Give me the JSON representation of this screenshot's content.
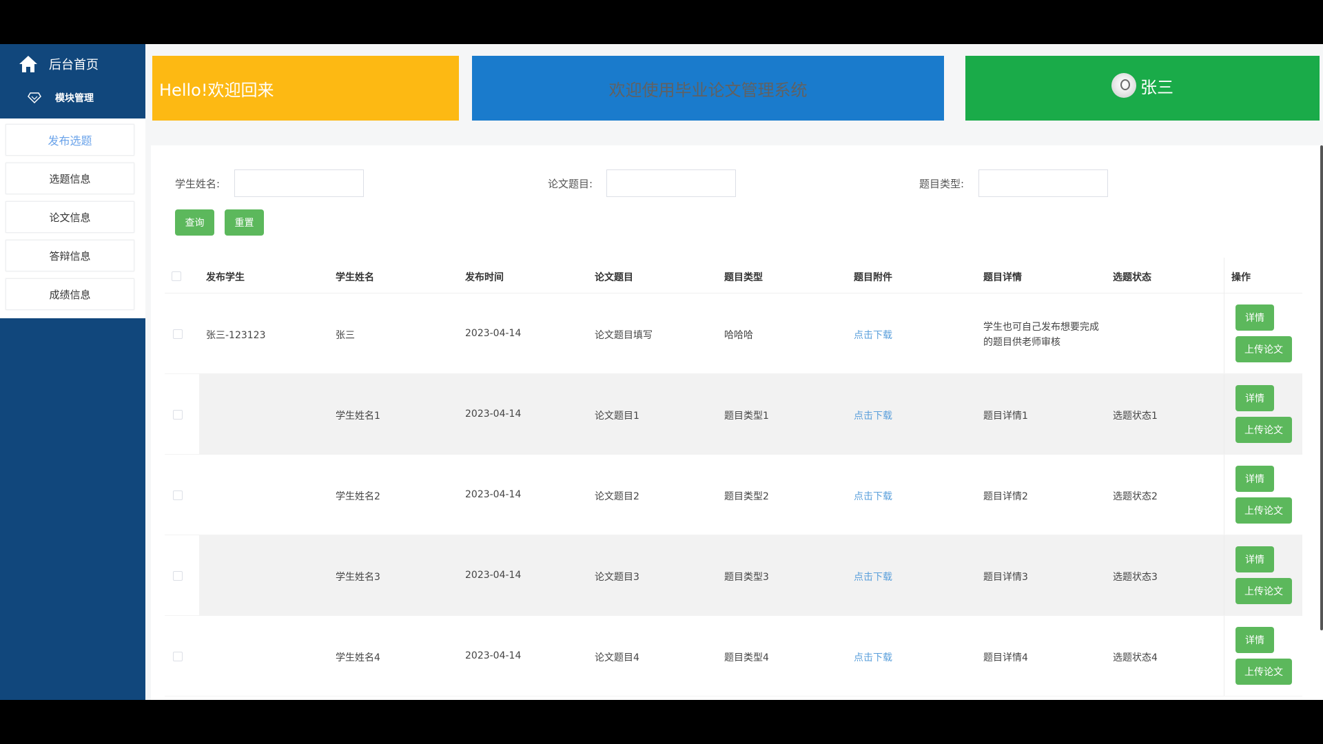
{
  "sidebar": {
    "home_label": "后台首页",
    "module_label": "模块管理",
    "items": [
      {
        "label": "发布选题",
        "active": true
      },
      {
        "label": "选题信息",
        "active": false
      },
      {
        "label": "论文信息",
        "active": false
      },
      {
        "label": "答辩信息",
        "active": false
      },
      {
        "label": "成绩信息",
        "active": false
      }
    ]
  },
  "banners": {
    "hello": "Hello!欢迎回来",
    "system": "欢迎使用毕业论文管理系统",
    "user": "张三"
  },
  "search": {
    "student_name_label": "学生姓名:",
    "thesis_title_label": "论文题目:",
    "topic_type_label": "题目类型:",
    "query_button": "查询",
    "reset_button": "重置"
  },
  "table": {
    "headers": [
      "发布学生",
      "学生姓名",
      "发布时间",
      "论文题目",
      "题目类型",
      "题目附件",
      "题目详情",
      "选题状态",
      "操作"
    ],
    "rows": [
      {
        "publisher": "张三-123123",
        "name": "张三",
        "time": "2023-04-14",
        "title": "论文题目填写",
        "type": "哈哈哈",
        "attachment": "点击下载",
        "detail": "学生也可自己发布想要完成的题目供老师审核",
        "status": ""
      },
      {
        "publisher": "",
        "name": "学生姓名1",
        "time": "2023-04-14",
        "title": "论文题目1",
        "type": "题目类型1",
        "attachment": "点击下载",
        "detail": "题目详情1",
        "status": "选题状态1"
      },
      {
        "publisher": "",
        "name": "学生姓名2",
        "time": "2023-04-14",
        "title": "论文题目2",
        "type": "题目类型2",
        "attachment": "点击下载",
        "detail": "题目详情2",
        "status": "选题状态2"
      },
      {
        "publisher": "",
        "name": "学生姓名3",
        "time": "2023-04-14",
        "title": "论文题目3",
        "type": "题目类型3",
        "attachment": "点击下载",
        "detail": "题目详情3",
        "status": "选题状态3"
      },
      {
        "publisher": "",
        "name": "学生姓名4",
        "time": "2023-04-14",
        "title": "论文题目4",
        "type": "题目类型4",
        "attachment": "点击下载",
        "detail": "题目详情4",
        "status": "选题状态4"
      }
    ],
    "detail_button": "详情",
    "upload_button": "上传论文"
  },
  "colors": {
    "sidebar": "#11477c",
    "hello_banner": "#fdb913",
    "system_banner": "#1a7bcc",
    "user_banner": "#1aab49",
    "button": "#5cb85c",
    "link": "#5a9fdb"
  }
}
